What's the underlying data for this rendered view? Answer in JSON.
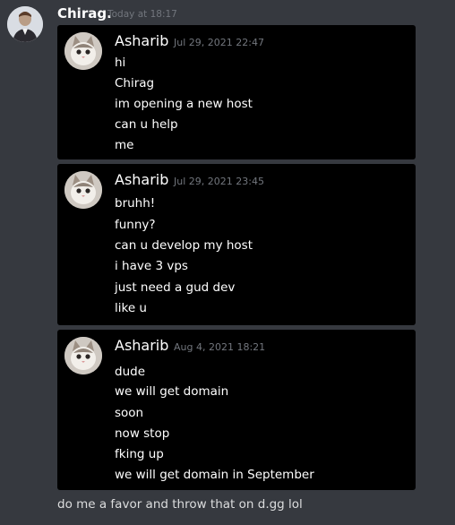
{
  "message": {
    "author": "Chirag.",
    "timestamp": "Today at 18:17",
    "embeds": [
      {
        "author": "Asharib",
        "time": "Jul 29, 2021 22:47",
        "lines": [
          "hi",
          "Chirag",
          "im opening a new host",
          "can u help",
          "me"
        ]
      },
      {
        "author": "Asharib",
        "time": "Jul 29, 2021 23:45",
        "lines": [
          "bruhh!",
          "funny?",
          "can u develop my host",
          "i have 3 vps",
          "just need a gud dev",
          "like u"
        ]
      },
      {
        "author": "Asharib",
        "time": "Aug 4, 2021 18:21",
        "lines": [
          "dude",
          "we will get domain",
          "soon",
          "now stop",
          "fking up",
          "we will get domain in September"
        ]
      }
    ],
    "text": "do me a favor and throw that on d.gg lol"
  },
  "icons": {
    "author_avatar": "person-avatar",
    "embed_avatar": "cat-avatar"
  },
  "colors": {
    "background": "#36393f",
    "embed_background": "#000000",
    "timestamp": "#72767d",
    "text": "#dcddde"
  }
}
